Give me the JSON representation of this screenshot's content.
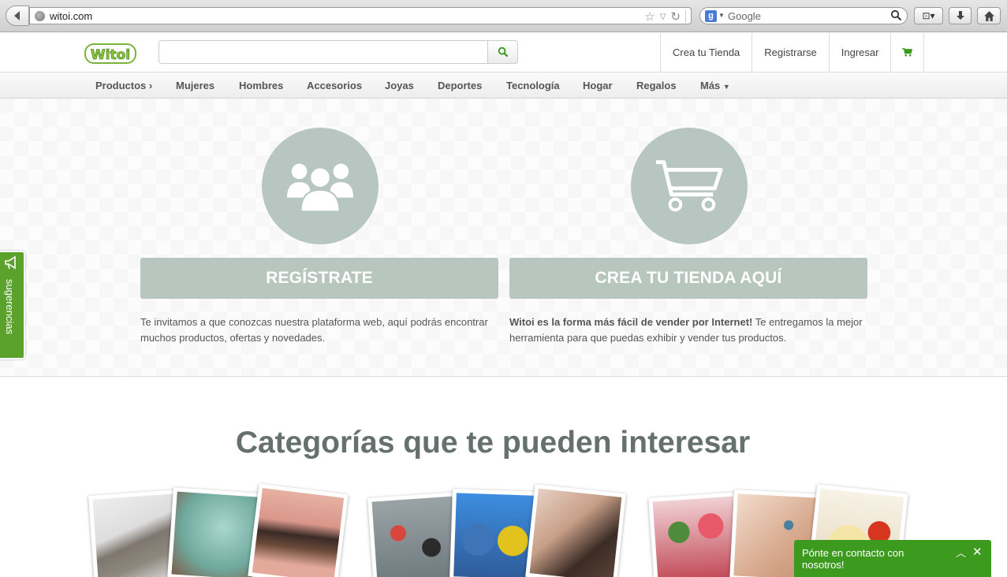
{
  "browser": {
    "url": "witoi.com",
    "search_engine_placeholder": "Google"
  },
  "header": {
    "logo_text": "Witoi",
    "search": {
      "value": "",
      "placeholder": ""
    },
    "links": [
      "Crea tu Tienda",
      "Registrarse",
      "Ingresar"
    ]
  },
  "nav": {
    "items": [
      "Productos",
      "Mujeres",
      "Hombres",
      "Accesorios",
      "Joyas",
      "Deportes",
      "Tecnología",
      "Hogar",
      "Regalos",
      "Más"
    ]
  },
  "hero": {
    "register_button": "REGÍSTRATE",
    "register_text": "Te invitamos a que conozcas nuestra plataforma web, aquí podrás encontrar muchos productos, ofertas y novedades.",
    "store_button": "CREA TU TIENDA AQUÍ",
    "store_text_bold": "Witoi es la forma más fácil de vender por Internet!",
    "store_text_rest": " Te entregamos la mejor herramienta para que puedas exhibir y vender tus productos."
  },
  "sidebar_tab": {
    "label": "sugerencias"
  },
  "categories": {
    "title": "Categorías que te pueden interesar"
  },
  "contact_widget": {
    "text": "Pónte en contacto con nosotros!"
  },
  "colors": {
    "brand_green": "#3c9a1e",
    "hero_gray": "#b8c6c0",
    "title_gray": "#66716d"
  }
}
